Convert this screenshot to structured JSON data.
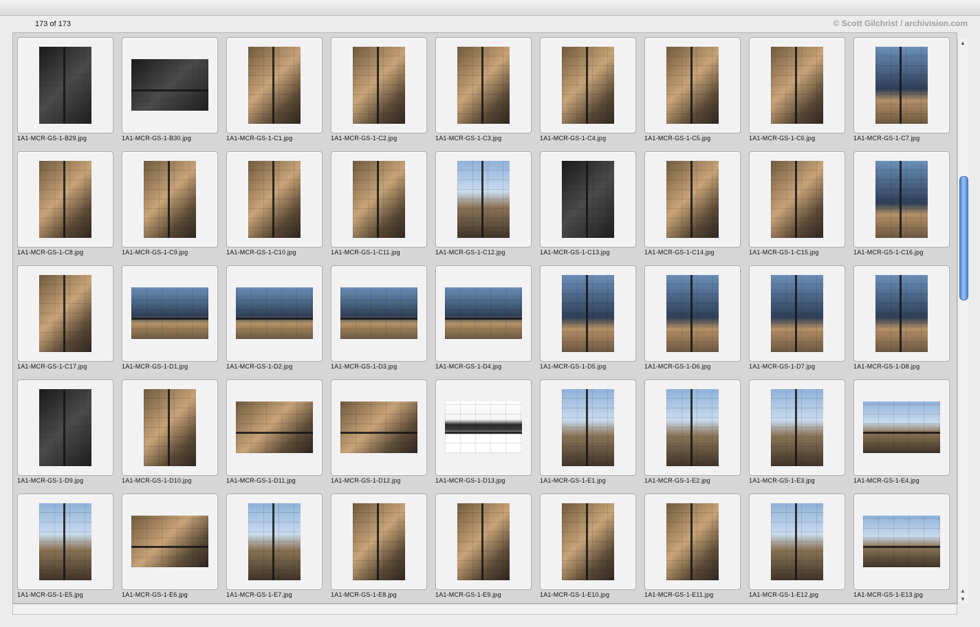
{
  "header": {
    "count_label": "173 of 173",
    "credit": "© Scott Gilchrist / archivision.com"
  },
  "thumbnails": [
    {
      "name": "1A1-MCR-GS-1-B29.jpg",
      "orient": "portrait",
      "tone": "dark"
    },
    {
      "name": "1A1-MCR-GS-1-B30.jpg",
      "orient": "landscape",
      "tone": "dark"
    },
    {
      "name": "1A1-MCR-GS-1-C1.jpg",
      "orient": "portrait",
      "tone": "stone"
    },
    {
      "name": "1A1-MCR-GS-1-C2.jpg",
      "orient": "portrait",
      "tone": "stone"
    },
    {
      "name": "1A1-MCR-GS-1-C3.jpg",
      "orient": "portrait",
      "tone": "stone"
    },
    {
      "name": "1A1-MCR-GS-1-C4.jpg",
      "orient": "portrait",
      "tone": "stone"
    },
    {
      "name": "1A1-MCR-GS-1-C5.jpg",
      "orient": "portrait",
      "tone": "stone"
    },
    {
      "name": "1A1-MCR-GS-1-C6.jpg",
      "orient": "portrait",
      "tone": "stone"
    },
    {
      "name": "1A1-MCR-GS-1-C7.jpg",
      "orient": "portrait",
      "tone": "win"
    },
    {
      "name": "1A1-MCR-GS-1-C8.jpg",
      "orient": "portrait",
      "tone": "stone"
    },
    {
      "name": "1A1-MCR-GS-1-C9.jpg",
      "orient": "portrait",
      "tone": "stone"
    },
    {
      "name": "1A1-MCR-GS-1-C10.jpg",
      "orient": "portrait",
      "tone": "stone"
    },
    {
      "name": "1A1-MCR-GS-1-C11.jpg",
      "orient": "portrait",
      "tone": "stone"
    },
    {
      "name": "1A1-MCR-GS-1-C12.jpg",
      "orient": "portrait",
      "tone": "sky"
    },
    {
      "name": "1A1-MCR-GS-1-C13.jpg",
      "orient": "portrait",
      "tone": "dark"
    },
    {
      "name": "1A1-MCR-GS-1-C14.jpg",
      "orient": "portrait",
      "tone": "stone"
    },
    {
      "name": "1A1-MCR-GS-1-C15.jpg",
      "orient": "portrait",
      "tone": "stone"
    },
    {
      "name": "1A1-MCR-GS-1-C16.jpg",
      "orient": "portrait",
      "tone": "win"
    },
    {
      "name": "1A1-MCR-GS-1-C17.jpg",
      "orient": "portrait",
      "tone": "stone"
    },
    {
      "name": "1A1-MCR-GS-1-D1.jpg",
      "orient": "landscape",
      "tone": "win"
    },
    {
      "name": "1A1-MCR-GS-1-D2.jpg",
      "orient": "landscape",
      "tone": "win"
    },
    {
      "name": "1A1-MCR-GS-1-D3.jpg",
      "orient": "landscape",
      "tone": "win"
    },
    {
      "name": "1A1-MCR-GS-1-D4.jpg",
      "orient": "landscape",
      "tone": "win"
    },
    {
      "name": "1A1-MCR-GS-1-D5.jpg",
      "orient": "portrait",
      "tone": "win"
    },
    {
      "name": "1A1-MCR-GS-1-D6.jpg",
      "orient": "portrait",
      "tone": "win"
    },
    {
      "name": "1A1-MCR-GS-1-D7.jpg",
      "orient": "portrait",
      "tone": "win"
    },
    {
      "name": "1A1-MCR-GS-1-D8.jpg",
      "orient": "portrait",
      "tone": "win"
    },
    {
      "name": "1A1-MCR-GS-1-D9.jpg",
      "orient": "portrait",
      "tone": "dark"
    },
    {
      "name": "1A1-MCR-GS-1-D10.jpg",
      "orient": "portrait",
      "tone": "stone"
    },
    {
      "name": "1A1-MCR-GS-1-D11.jpg",
      "orient": "landscape",
      "tone": "stone"
    },
    {
      "name": "1A1-MCR-GS-1-D12.jpg",
      "orient": "landscape",
      "tone": "stone"
    },
    {
      "name": "1A1-MCR-GS-1-D13.jpg",
      "orient": "landscape",
      "tone": "white"
    },
    {
      "name": "1A1-MCR-GS-1-E1.jpg",
      "orient": "portrait",
      "tone": "sky"
    },
    {
      "name": "1A1-MCR-GS-1-E2.jpg",
      "orient": "portrait",
      "tone": "sky"
    },
    {
      "name": "1A1-MCR-GS-1-E3.jpg",
      "orient": "portrait",
      "tone": "sky"
    },
    {
      "name": "1A1-MCR-GS-1-E4.jpg",
      "orient": "landscape",
      "tone": "sky"
    },
    {
      "name": "1A1-MCR-GS-1-E5.jpg",
      "orient": "portrait",
      "tone": "sky"
    },
    {
      "name": "1A1-MCR-GS-1-E6.jpg",
      "orient": "landscape",
      "tone": "stone"
    },
    {
      "name": "1A1-MCR-GS-1-E7.jpg",
      "orient": "portrait",
      "tone": "sky"
    },
    {
      "name": "1A1-MCR-GS-1-E8.jpg",
      "orient": "portrait",
      "tone": "stone"
    },
    {
      "name": "1A1-MCR-GS-1-E9.jpg",
      "orient": "portrait",
      "tone": "stone"
    },
    {
      "name": "1A1-MCR-GS-1-E10.jpg",
      "orient": "portrait",
      "tone": "stone"
    },
    {
      "name": "1A1-MCR-GS-1-E11.jpg",
      "orient": "portrait",
      "tone": "stone"
    },
    {
      "name": "1A1-MCR-GS-1-E12.jpg",
      "orient": "portrait",
      "tone": "sky"
    },
    {
      "name": "1A1-MCR-GS-1-E13.jpg",
      "orient": "landscape",
      "tone": "sky"
    }
  ],
  "scrollbar": {
    "position": 0.22,
    "visible_fraction": 0.26
  }
}
